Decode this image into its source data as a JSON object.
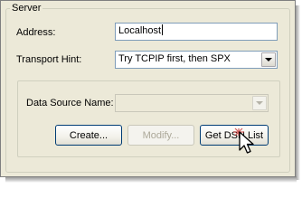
{
  "server_group": {
    "title": "Server",
    "address_label": "Address:",
    "address_value": "Localhost",
    "transport_label": "Transport Hint:",
    "transport_value": "Try TCPIP first, then SPX"
  },
  "dsn_group": {
    "data_source_label": "Data Source Name:",
    "data_source_value": ""
  },
  "buttons": {
    "create": "Create...",
    "modify": "Modify...",
    "get_dsn_list": "Get DSN List"
  },
  "icons": {
    "cursor": "hand-pointer-icon",
    "dropdown": "chevron-down-icon"
  }
}
